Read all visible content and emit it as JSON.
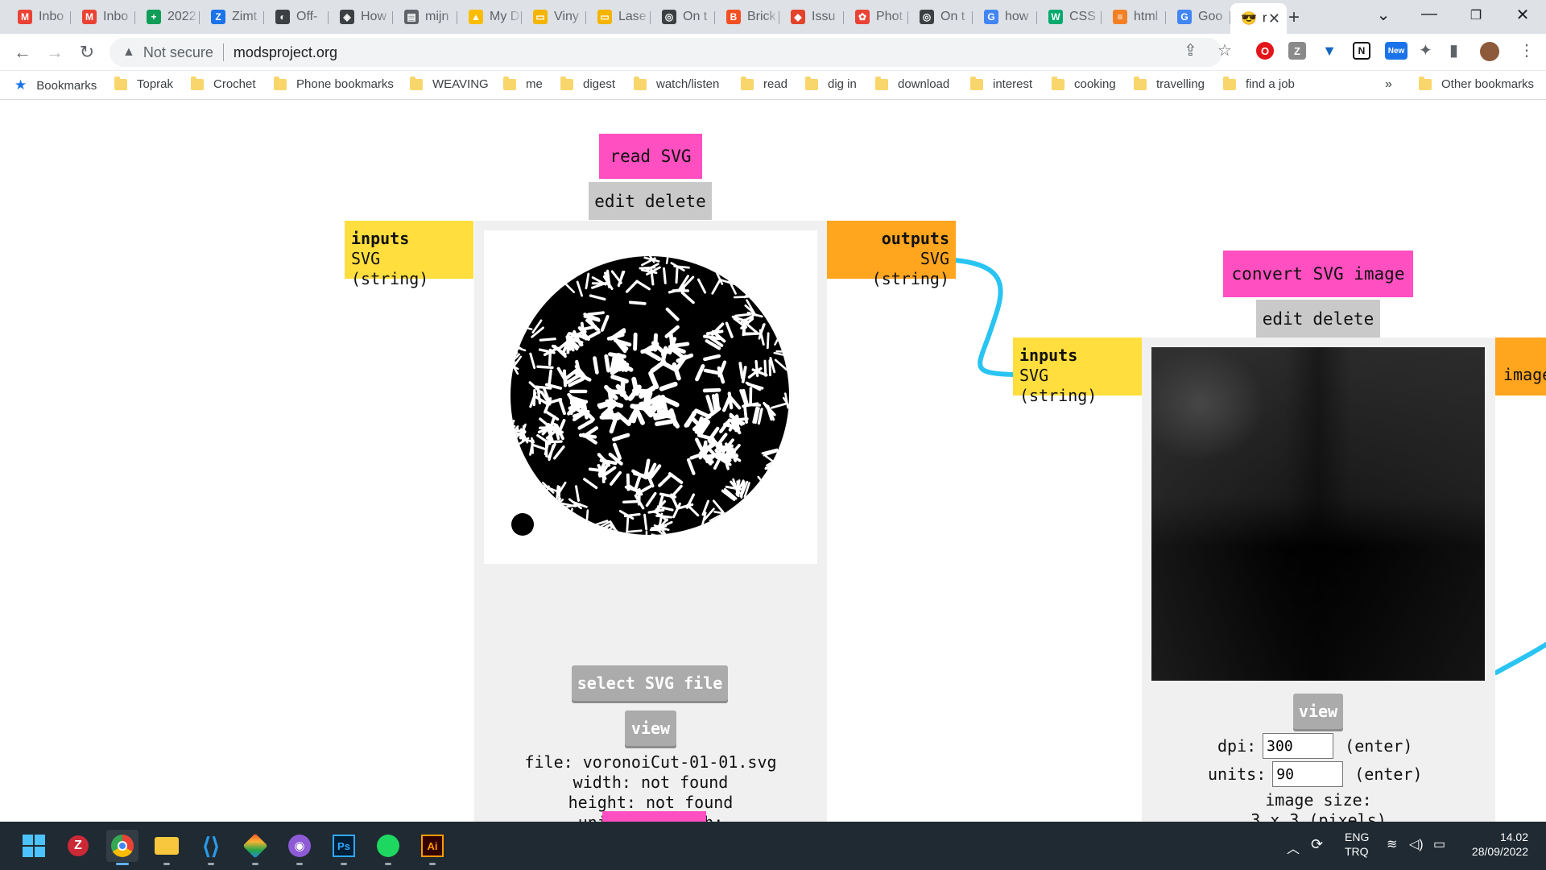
{
  "tabs": [
    {
      "label": "Inbo",
      "icon": "gmail-icon",
      "color": "#ea4335",
      "glyph": "M"
    },
    {
      "label": "Inbo",
      "icon": "gmail-icon",
      "color": "#ea4335",
      "glyph": "M"
    },
    {
      "label": "2022",
      "icon": "sheets-icon",
      "color": "#0f9d58",
      "glyph": "+"
    },
    {
      "label": "Zimt",
      "icon": "zimt-icon",
      "color": "#1a73e8",
      "glyph": "Z"
    },
    {
      "label": "Off-",
      "icon": "web-icon",
      "color": "#3c4043",
      "glyph": "◐"
    },
    {
      "label": "How",
      "icon": "web-icon",
      "color": "#3c4043",
      "glyph": "◈"
    },
    {
      "label": "mijn",
      "icon": "doc-icon",
      "color": "#5f6368",
      "glyph": "▤"
    },
    {
      "label": "My D",
      "icon": "drive-icon",
      "color": "#fbbc04",
      "glyph": "▲"
    },
    {
      "label": "Viny",
      "icon": "slides-icon",
      "color": "#f4b400",
      "glyph": "▭"
    },
    {
      "label": "Lase",
      "icon": "slides-icon",
      "color": "#f4b400",
      "glyph": "▭"
    },
    {
      "label": "On t",
      "icon": "web-icon",
      "color": "#3c4043",
      "glyph": "◎"
    },
    {
      "label": "Brick",
      "icon": "brick-icon",
      "color": "#f25022",
      "glyph": "B"
    },
    {
      "label": "Issu",
      "icon": "gitlab-icon",
      "color": "#e24329",
      "glyph": "◆"
    },
    {
      "label": "Phot",
      "icon": "photos-icon",
      "color": "#ea4335",
      "glyph": "✿"
    },
    {
      "label": "On t",
      "icon": "web-icon",
      "color": "#3c4043",
      "glyph": "◎"
    },
    {
      "label": "how",
      "icon": "google-icon",
      "color": "#4285f4",
      "glyph": "G"
    },
    {
      "label": "CSS",
      "icon": "w3-icon",
      "color": "#04aa6d",
      "glyph": "W"
    },
    {
      "label": "html",
      "icon": "stackoverflow-icon",
      "color": "#f48024",
      "glyph": "≡"
    },
    {
      "label": "Goo",
      "icon": "translate-icon",
      "color": "#4285f4",
      "glyph": "G"
    },
    {
      "label": "r",
      "icon": "sunglasses-emoji-icon",
      "color": "#f9c80e",
      "glyph": "😎",
      "active": true
    }
  ],
  "address": {
    "security_label": "Not secure",
    "url": "modsproject.org"
  },
  "bookmarks": {
    "bookmarks_label": "Bookmarks",
    "folders": [
      "Toprak",
      "Crochet",
      "Phone bookmarks",
      "WEAVING",
      "me",
      "digest",
      "watch/listen",
      "read",
      "dig in",
      "download",
      "interest",
      "cooking",
      "travelling",
      "find a job"
    ],
    "overflow": "»",
    "other": "Other bookmarks"
  },
  "read_svg_module": {
    "title": "read SVG",
    "edit_label": "edit",
    "delete_label": "delete",
    "inputs_header": "inputs",
    "inputs_type": "SVG (string)",
    "outputs_header": "outputs",
    "outputs_type": "SVG (string)",
    "select_button": "select SVG file",
    "view_button": "view",
    "file_line": "file: voronoiCut-01-01.svg",
    "width_line": "width: not found",
    "height_line": "height: not found",
    "units_line": "units per inch:"
  },
  "convert_module": {
    "title": "convert SVG image",
    "edit_label": "edit",
    "delete_label": "delete",
    "inputs_header": "inputs",
    "inputs_type": "SVG (string)",
    "output_partial": "image",
    "view_button": "view",
    "dpi_label": "dpi:",
    "dpi_value": "300",
    "dpi_enter": "(enter)",
    "units_label": "units:",
    "units_value": "90",
    "units_enter": "(enter)",
    "image_size_label": "image size:",
    "image_size_value": "3 x 3 (pixels)"
  },
  "colors": {
    "module_title": "#ff4fc0",
    "inputs": "#ffde3d",
    "outputs": "#ffa51e",
    "wire": "#29c4f2",
    "panel": "#f0f0f0"
  },
  "taskbar": {
    "apps": [
      "windows-start-icon",
      "zotero-icon",
      "chrome-icon",
      "file-explorer-icon",
      "vscode-icon",
      "git-icon",
      "github-desktop-icon",
      "photoshop-icon",
      "spotify-icon",
      "illustrator-icon"
    ],
    "lang_top": "ENG",
    "lang_bottom": "TRQ",
    "time": "14.02",
    "date": "28/09/2022"
  }
}
